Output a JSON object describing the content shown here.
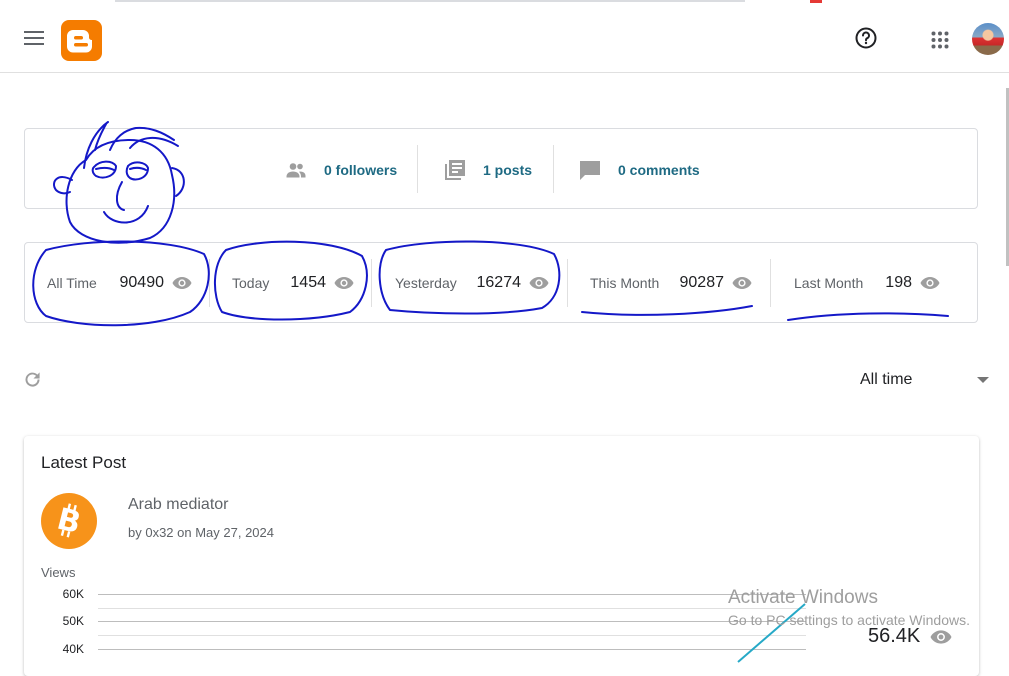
{
  "header": {
    "menu_icon": "menu-icon",
    "logo_icon": "blogger-logo-icon",
    "help_icon": "help-circle-icon",
    "apps_icon": "apps-grid-icon",
    "avatar_icon": "user-avatar"
  },
  "summary": {
    "followers": "0 followers",
    "posts": "1 posts",
    "comments": "0 comments"
  },
  "views": [
    {
      "label": "All Time",
      "value": "90490"
    },
    {
      "label": "Today",
      "value": "1454"
    },
    {
      "label": "Yesterday",
      "value": "16274"
    },
    {
      "label": "This Month",
      "value": "90287"
    },
    {
      "label": "Last Month",
      "value": "198"
    }
  ],
  "controls": {
    "range": "All time"
  },
  "latest": {
    "title": "Latest Post",
    "post_title": "Arab mediator",
    "post_meta": "by 0x32 on May 27, 2024",
    "views_label": "Views",
    "ticks": [
      "60K",
      "50K",
      "40K"
    ],
    "total": "56.4K"
  },
  "watermark": {
    "line1": "Activate Windows",
    "line2": "Go to PC settings to activate Windows."
  },
  "colors": {
    "accent": "#1e6a83",
    "brand": "#f57c00",
    "chart_line": "#26a9c7",
    "doodle": "#1418c8"
  }
}
